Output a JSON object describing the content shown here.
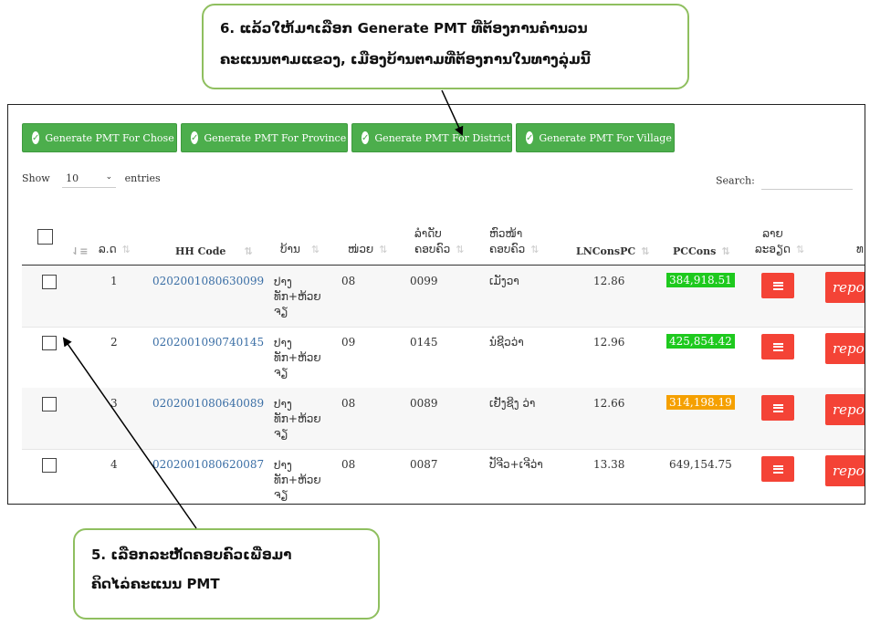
{
  "buttons": [
    {
      "label": "Generate PMT For Chose"
    },
    {
      "label": "Generate PMT For Province"
    },
    {
      "label": "Generate PMT For District"
    },
    {
      "label": "Generate PMT For Village"
    }
  ],
  "table_controls": {
    "show_label": "Show",
    "entries_value": "10",
    "entries_label": "entries",
    "search_label": "Search:"
  },
  "columns": {
    "no": "ລ.ດ",
    "hh_code": "HH Code",
    "village": "ບ້ານ",
    "unit": "ໜ່ວຍ",
    "hh_order_1": "ລຳດັບ",
    "hh_order_2": "ຄອບຄົວ",
    "hh_head_1": "ຫົວໜ້າ",
    "hh_head_2": "ຄອບຄົວ",
    "lncons": "LNConsPC",
    "pccons": "PCCons",
    "detail_1": "ລາຍ",
    "detail_2": "ລະອຽດ",
    "last": "ທ"
  },
  "rows": [
    {
      "no": "1",
      "hh_code": "0202001080630099",
      "village_1": "ປາງ",
      "village_2": "ທັກ+ຫ້ວຍ",
      "village_3": "ຈຽ",
      "unit": "08",
      "hh_order": "0099",
      "head": "ເມັງວາ",
      "lncons": "12.86",
      "pccons": "384,918.51",
      "pc_color": "#1ec91e",
      "report": "repo"
    },
    {
      "no": "2",
      "hh_code": "0202001090740145",
      "village_1": "ປາງ",
      "village_2": "ທັກ+ຫ້ວຍ",
      "village_3": "ຈຽ",
      "unit": "09",
      "hh_order": "0145",
      "head": "ນໍຊີວວ່າ",
      "lncons": "12.96",
      "pccons": "425,854.42",
      "pc_color": "#1ec91e",
      "report": "repo"
    },
    {
      "no": "3",
      "hh_code": "0202001080640089",
      "village_1": "ປາງ",
      "village_2": "ທັກ+ຫ້ວຍ",
      "village_3": "ຈຽ",
      "unit": "08",
      "hh_order": "0089",
      "head": "ເຢັງຊີງ ວ່າ",
      "lncons": "12.66",
      "pccons": "314,198.19",
      "pc_color": "#f5a000",
      "report": "repo"
    },
    {
      "no": "4",
      "hh_code": "0202001080620087",
      "village_1": "ປາງ",
      "village_2": "ທັກ+ຫ້ວຍ",
      "village_3": "ຈຽ",
      "unit": "08",
      "hh_order": "0087",
      "head": "ປັຈີວ+ເຈີວ່າ",
      "lncons": "13.38",
      "pccons": "649,154.75",
      "pc_color": "",
      "report": "repo"
    }
  ],
  "callout_top": {
    "line1": "6. ແລ້ວໃຫ້ມາເລືອກ Generate PMT ທີ່ຕ້ອງການຄຳນວນ",
    "line2": "ຄະແນນຕາມແຂວງ, ເມືອງບ້ານຕາມທີ່ຕ້ອງການໃນທາງລຸ່ມນີ້"
  },
  "callout_bottom": {
    "line1": "5. ເລືອກລະຫັດຄອບຄົວເພື່ອມາ",
    "line2": "ຄິດໄລ່ຄະແນນ PMT"
  },
  "icons": {
    "check": "check-circle-icon",
    "sort": "sort-icon",
    "menu": "list-icon"
  }
}
